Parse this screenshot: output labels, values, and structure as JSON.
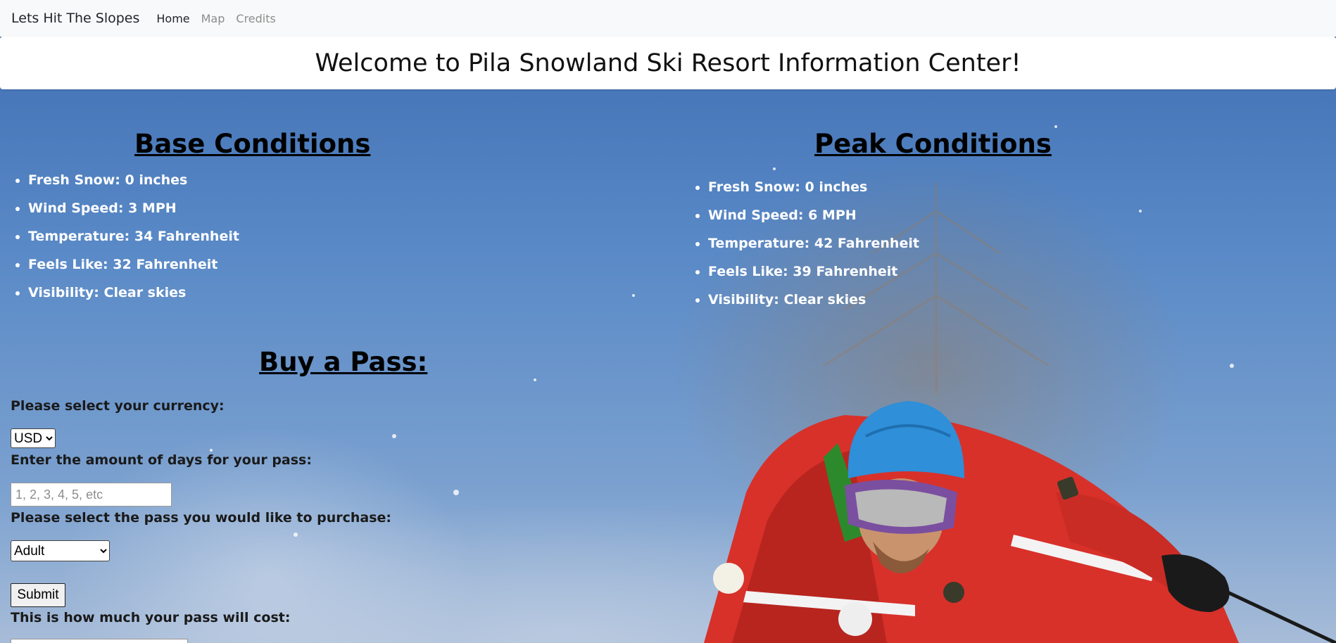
{
  "navbar": {
    "brand": "Lets Hit The Slopes",
    "links": [
      {
        "label": "Home",
        "active": true
      },
      {
        "label": "Map",
        "active": false
      },
      {
        "label": "Credits",
        "active": false
      }
    ]
  },
  "banner": {
    "title": "Welcome to Pila Snowland Ski Resort Information Center!"
  },
  "base_conditions": {
    "heading": "Base Conditions",
    "items": [
      "Fresh Snow: 0 inches",
      "Wind Speed: 3 MPH",
      "Temperature: 34 Fahrenheit",
      "Feels Like: 32 Fahrenheit",
      "Visibility: Clear skies"
    ]
  },
  "peak_conditions": {
    "heading": "Peak Conditions",
    "items": [
      "Fresh Snow: 0 inches",
      "Wind Speed: 6 MPH",
      "Temperature: 42 Fahrenheit",
      "Feels Like: 39 Fahrenheit",
      "Visibility: Clear skies"
    ]
  },
  "buy_pass": {
    "heading": "Buy a Pass:",
    "currency_label": "Please select your currency:",
    "currency_value": "USD",
    "days_label": "Enter the amount of days for your pass:",
    "days_placeholder": "1, 2, 3, 4, 5, etc",
    "pass_label": "Please select the pass you would like to purchase:",
    "pass_value": "Adult",
    "submit_label": "Submit",
    "cost_label": "This is how much your pass will cost:"
  },
  "colors": {
    "navbar_bg": "#f8f9fa",
    "sky": "#4f7fbf",
    "jacket": "#d8312a",
    "helmet": "#2f8fd8"
  }
}
